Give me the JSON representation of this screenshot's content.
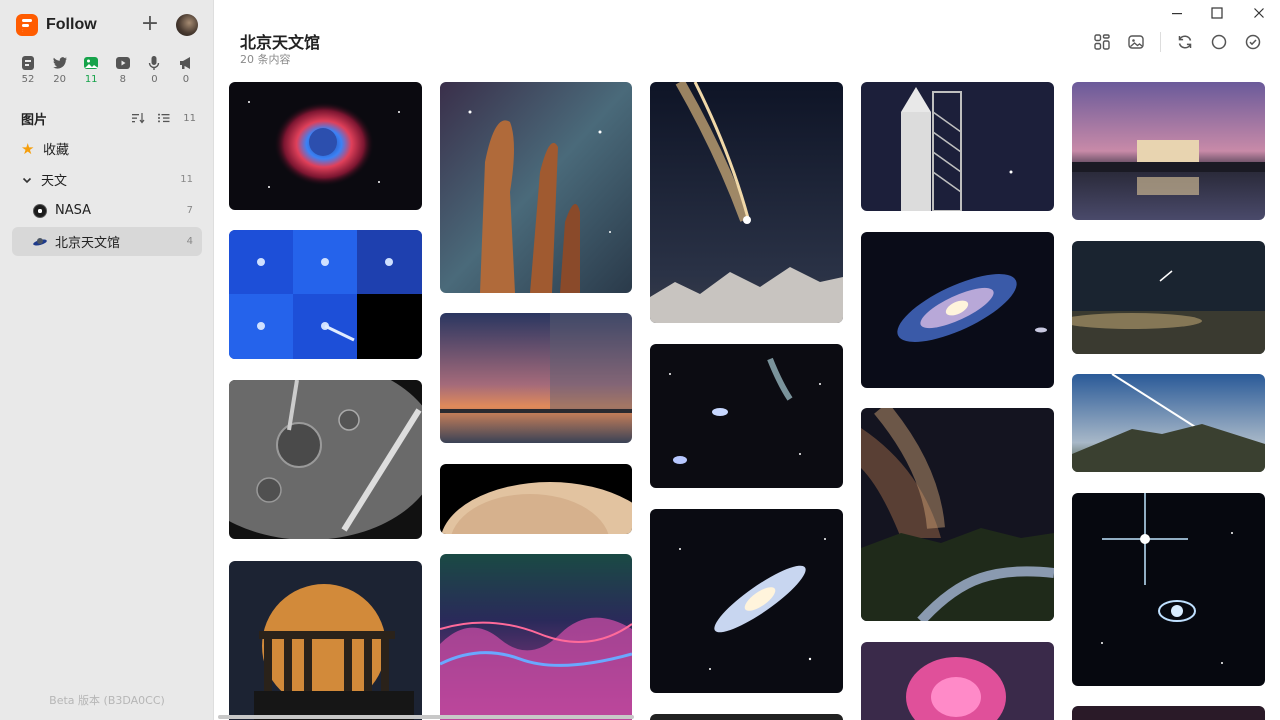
{
  "app": {
    "name": "Follow",
    "beta_label": "Beta 版本 (B3DA0CC)"
  },
  "views": [
    {
      "name": "articles",
      "count": "52"
    },
    {
      "name": "social",
      "count": "20"
    },
    {
      "name": "pictures",
      "count": "11"
    },
    {
      "name": "videos",
      "count": "8"
    },
    {
      "name": "audio",
      "count": "0"
    },
    {
      "name": "notifications",
      "count": "0"
    }
  ],
  "sidebar": {
    "section_title": "图片",
    "section_count": "11",
    "items": [
      {
        "label": "收藏",
        "count": ""
      },
      {
        "label": "天文",
        "count": "11"
      },
      {
        "label": "NASA",
        "count": "7"
      },
      {
        "label": "北京天文馆",
        "count": "4"
      }
    ]
  },
  "main": {
    "title": "北京天文馆",
    "subtitle": "20 条内容"
  },
  "colors": {
    "accent": "#ff5c00",
    "active_view": "#16a34a",
    "star": "#f59e0b"
  },
  "images": [
    {
      "name": "helix-nebula"
    },
    {
      "name": "soho-coronagraph"
    },
    {
      "name": "moon-craters-spacecraft"
    },
    {
      "name": "full-moon-temple"
    },
    {
      "name": "pillars-of-creation"
    },
    {
      "name": "sunset-timelapse"
    },
    {
      "name": "mars-horizon"
    },
    {
      "name": "nebula-filaments"
    },
    {
      "name": "comet-over-mountains"
    },
    {
      "name": "comet-and-galaxies"
    },
    {
      "name": "spiral-galaxy-edge"
    },
    {
      "name": "rocket-launch-tower"
    },
    {
      "name": "andromeda-galaxy"
    },
    {
      "name": "milky-way-river"
    },
    {
      "name": "pink-nebula"
    },
    {
      "name": "lincoln-memorial-dusk"
    },
    {
      "name": "meteor-over-clouds"
    },
    {
      "name": "satellite-trail-landscape"
    },
    {
      "name": "neptune-rings"
    },
    {
      "name": "dark-sky-card"
    }
  ]
}
